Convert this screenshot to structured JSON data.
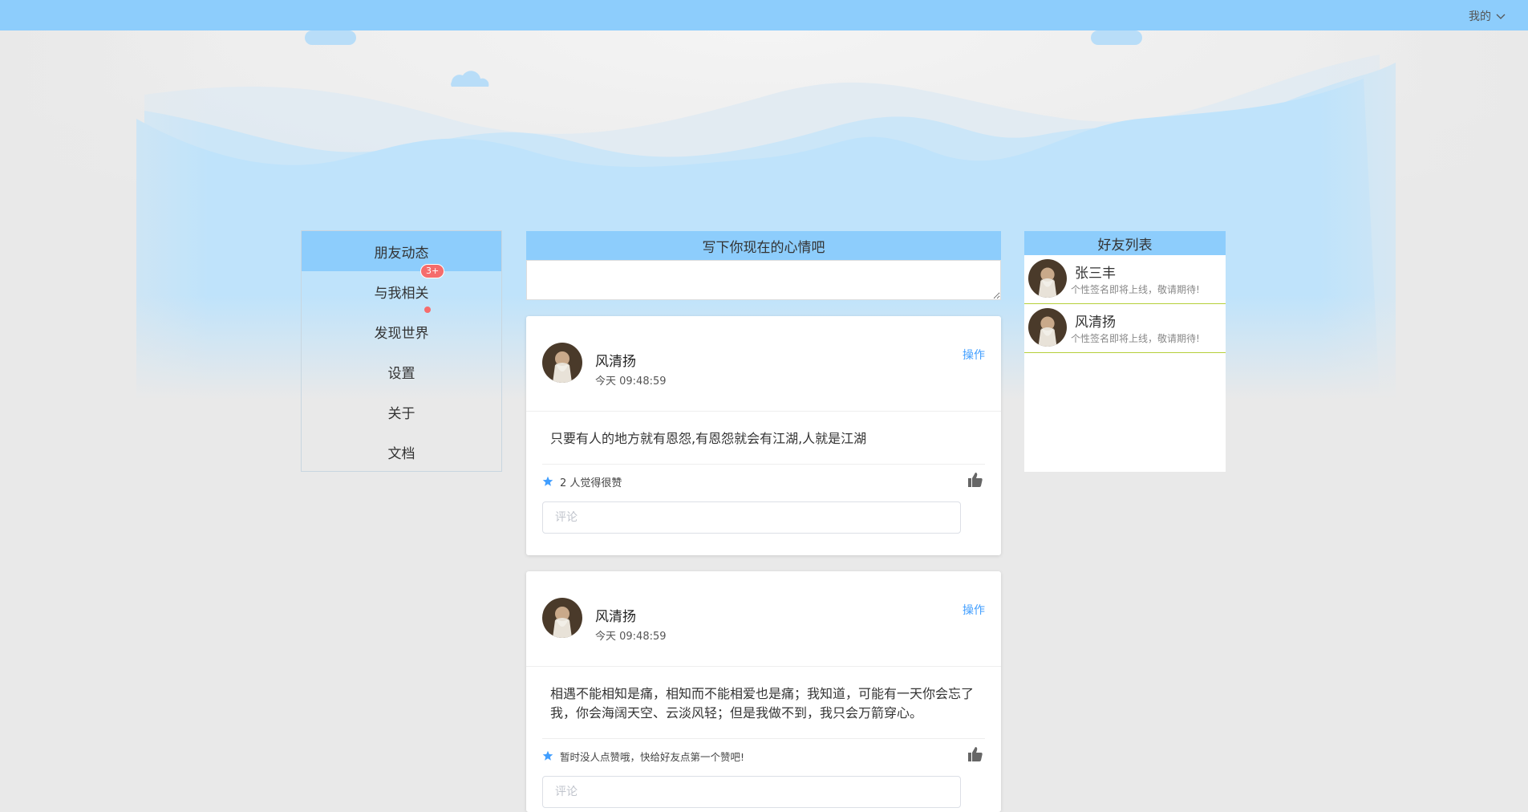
{
  "header": {
    "user_menu_label": "我的",
    "user_menu_icon": "chevron-down-icon"
  },
  "menu": {
    "items": [
      {
        "label": "朋友动态",
        "active": true
      },
      {
        "label": "与我相关",
        "badge": "3+"
      },
      {
        "label": "发现世界",
        "dot": true
      },
      {
        "label": "设置"
      },
      {
        "label": "关于"
      },
      {
        "label": "文档"
      }
    ]
  },
  "mood": {
    "title": "写下你现在的心情吧",
    "value": ""
  },
  "posts": [
    {
      "author": "风清扬",
      "time": "今天 09:48:59",
      "action": "操作",
      "content": "只要有人的地方就有恩怨,有恩怨就会有江湖,人就是江湖",
      "likes_text": "2 人觉得很赞",
      "comment_placeholder": "评论"
    },
    {
      "author": "风清扬",
      "time": "今天 09:48:59",
      "action": "操作",
      "content": "相遇不能相知是痛，相知而不能相爱也是痛；我知道，可能有一天你会忘了我，你会海阔天空、云淡风轻；但是我做不到，我只会万箭穿心。",
      "likes_text": "暂时没人点赞哦，快给好友点第一个赞吧!",
      "comment_placeholder": "评论"
    }
  ],
  "friends": {
    "title": "好友列表",
    "items": [
      {
        "name": "张三丰",
        "signature": "个性签名即将上线，敬请期待!"
      },
      {
        "name": "风清扬",
        "signature": "个性签名即将上线，敬请期待!"
      }
    ]
  },
  "colors": {
    "accent": "#8dcdfc",
    "link": "#409eff",
    "badge": "#f56c6c",
    "friend_divider": "#b5cf3a"
  }
}
